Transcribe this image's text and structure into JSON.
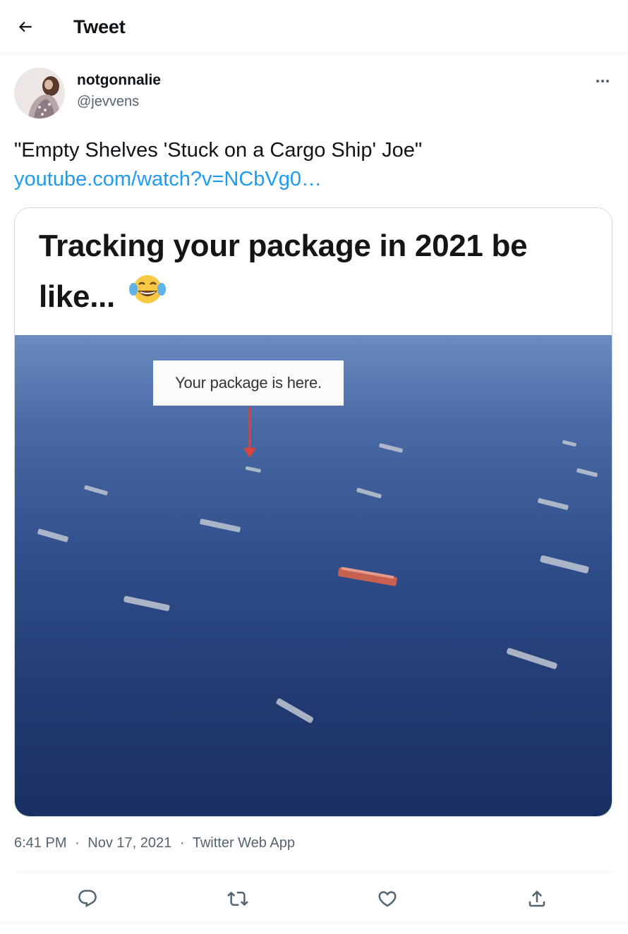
{
  "header": {
    "title": "Tweet",
    "back_icon": "arrow-left-icon"
  },
  "author": {
    "display_name": "notgonnalie",
    "handle": "@jevvens",
    "more_icon": "more-horizontal-icon"
  },
  "tweet": {
    "text": "\"Empty Shelves 'Stuck on a Cargo Ship' Joe\"",
    "link": "youtube.com/watch?v=NCbVg0…"
  },
  "media": {
    "caption": "Tracking your package in 2021 be like...",
    "caption_emoji": "laughing-crying-emoji",
    "callout": "Your package is here."
  },
  "meta": {
    "time": "6:41 PM",
    "separator": "·",
    "date": "Nov 17, 2021",
    "source": "Twitter Web App"
  },
  "actions": {
    "reply_icon": "reply-icon",
    "retweet_icon": "retweet-icon",
    "like_icon": "heart-icon",
    "share_icon": "share-icon"
  },
  "colors": {
    "link": "#1d9bf0",
    "secondary_text": "#536471",
    "border": "#cfd9de",
    "divider": "#eff3f4"
  }
}
